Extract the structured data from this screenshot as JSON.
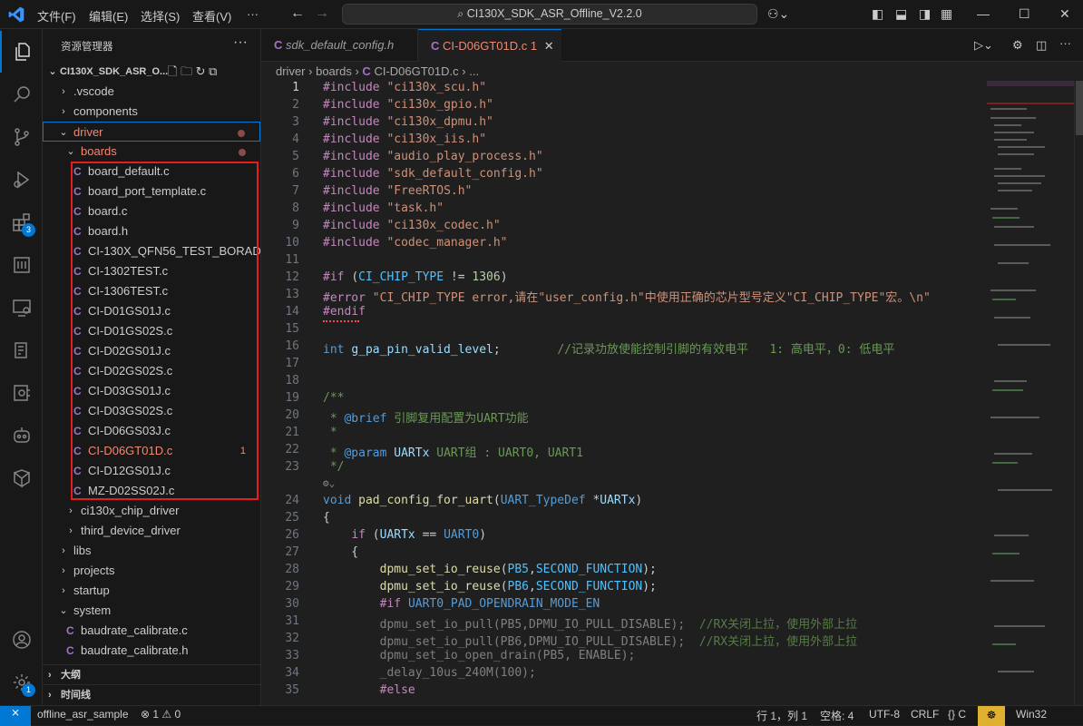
{
  "titlebar": {
    "menus": [
      "文件(F)",
      "编辑(E)",
      "选择(S)",
      "查看(V)"
    ],
    "more": "···",
    "search_text": "CI130X_SDK_ASR_Offline_V2.2.0"
  },
  "activity": {
    "extensions_badge": "3",
    "settings_badge": "1"
  },
  "sidebar": {
    "title": "资源管理器",
    "more": "···",
    "root": "CI130X_SDK_ASR_O...",
    "items": [
      {
        "label": ".vscode"
      },
      {
        "label": "components"
      },
      {
        "label": "driver"
      },
      {
        "label": "boards"
      },
      {
        "label": "board_default.c"
      },
      {
        "label": "board_port_template.c"
      },
      {
        "label": "board.c"
      },
      {
        "label": "board.h"
      },
      {
        "label": "CI-130X_QFN56_TEST_BORAD.c"
      },
      {
        "label": "CI-1302TEST.c"
      },
      {
        "label": "CI-1306TEST.c"
      },
      {
        "label": "CI-D01GS01J.c"
      },
      {
        "label": "CI-D01GS02S.c"
      },
      {
        "label": "CI-D02GS01J.c"
      },
      {
        "label": "CI-D02GS02S.c"
      },
      {
        "label": "CI-D03GS01J.c"
      },
      {
        "label": "CI-D03GS02S.c"
      },
      {
        "label": "CI-D06GS03J.c"
      },
      {
        "label": "CI-D06GT01D.c",
        "errors": "1"
      },
      {
        "label": "CI-D12GS01J.c"
      },
      {
        "label": "MZ-D02SS02J.c"
      },
      {
        "label": "ci130x_chip_driver"
      },
      {
        "label": "third_device_driver"
      },
      {
        "label": "libs"
      },
      {
        "label": "projects"
      },
      {
        "label": "startup"
      },
      {
        "label": "system"
      },
      {
        "label": "baudrate_calibrate.c"
      },
      {
        "label": "baudrate_calibrate.h"
      }
    ],
    "outline": "大纲",
    "timeline": "时间线"
  },
  "tabs": [
    {
      "label": "sdk_default_config.h"
    },
    {
      "label": "CI-D06GT01D.c",
      "errors": "1"
    }
  ],
  "breadcrumb": [
    "driver",
    "boards",
    "CI-D06GT01D.c",
    "..."
  ],
  "code": {
    "line_numbers": [
      "1",
      "2",
      "3",
      "4",
      "5",
      "6",
      "7",
      "8",
      "9",
      "10",
      "11",
      "12",
      "13",
      "14",
      "15",
      "16",
      "17",
      "18",
      "19",
      "20",
      "21",
      "22",
      "23",
      "24",
      "25",
      "26",
      "27",
      "28",
      "29",
      "30",
      "31",
      "32",
      "33",
      "34",
      "35"
    ],
    "lines": [
      [
        [
          "kw",
          "#include "
        ],
        [
          "str",
          "\"ci130x_scu.h\""
        ]
      ],
      [
        [
          "kw",
          "#include "
        ],
        [
          "str",
          "\"ci130x_gpio.h\""
        ]
      ],
      [
        [
          "kw",
          "#include "
        ],
        [
          "str",
          "\"ci130x_dpmu.h\""
        ]
      ],
      [
        [
          "kw",
          "#include "
        ],
        [
          "str",
          "\"ci130x_iis.h\""
        ]
      ],
      [
        [
          "kw",
          "#include "
        ],
        [
          "str",
          "\"audio_play_process.h\""
        ]
      ],
      [
        [
          "kw",
          "#include "
        ],
        [
          "str",
          "\"sdk_default_config.h\""
        ]
      ],
      [
        [
          "kw",
          "#include "
        ],
        [
          "str",
          "\"FreeRTOS.h\""
        ]
      ],
      [
        [
          "kw",
          "#include "
        ],
        [
          "str",
          "\"task.h\""
        ]
      ],
      [
        [
          "kw",
          "#include "
        ],
        [
          "str",
          "\"ci130x_codec.h\""
        ]
      ],
      [
        [
          "kw",
          "#include "
        ],
        [
          "str",
          "\"codec_manager.h\""
        ]
      ],
      [],
      [
        [
          "kw",
          "#if "
        ],
        [
          "t",
          "("
        ],
        [
          "mac",
          "CI_CHIP_TYPE"
        ],
        [
          "t",
          " != "
        ],
        [
          "num",
          "1306"
        ],
        [
          "t",
          ")"
        ]
      ],
      [
        [
          "kw",
          "#error "
        ],
        [
          "str",
          "\"CI_CHIP_TYPE error,请在\"user_config.h\"中使用正确的芯片型号定义\"CI_CHIP_TYPE\"宏。\\n\""
        ]
      ],
      [
        [
          "kw",
          "#endif"
        ]
      ],
      [],
      [
        [
          "ty",
          "int "
        ],
        [
          "var",
          "g_pa_pin_valid_level"
        ],
        [
          "t",
          ";        "
        ],
        [
          "cm",
          "//记录功放使能控制引脚的有效电平   1: 高电平，0: 低电平"
        ]
      ],
      [],
      [],
      [
        [
          "cm",
          "/**"
        ]
      ],
      [
        [
          "cm",
          " * "
        ],
        [
          "tag",
          "@brief "
        ],
        [
          "cm",
          "引脚复用配置为UART功能"
        ]
      ],
      [
        [
          "cm",
          " *"
        ]
      ],
      [
        [
          "cm",
          " * "
        ],
        [
          "tag",
          "@param "
        ],
        [
          "var",
          "UARTx "
        ],
        [
          "cm",
          "UART组 : UART0, UART1"
        ]
      ],
      [
        [
          "cm",
          " */"
        ]
      ],
      [
        [
          "ty",
          "void "
        ],
        [
          "fn",
          "pad_config_for_uart"
        ],
        [
          "t",
          "("
        ],
        [
          "ty",
          "UART_TypeDef "
        ],
        [
          "t",
          "*"
        ],
        [
          "var",
          "UARTx"
        ],
        [
          "t",
          ")"
        ]
      ],
      [
        [
          "t",
          "{"
        ]
      ],
      [
        [
          "t",
          "    "
        ],
        [
          "kw",
          "if "
        ],
        [
          "t",
          "("
        ],
        [
          "var",
          "UARTx"
        ],
        [
          "t",
          " == "
        ],
        [
          "ty",
          "UART0"
        ],
        [
          "t",
          ")"
        ]
      ],
      [
        [
          "t",
          "    {"
        ]
      ],
      [
        [
          "t",
          "        "
        ],
        [
          "fn",
          "dpmu_set_io_reuse"
        ],
        [
          "t",
          "("
        ],
        [
          "mac",
          "PB5"
        ],
        [
          "t",
          ","
        ],
        [
          "mac",
          "SECOND_FUNCTION"
        ],
        [
          "t",
          ");"
        ]
      ],
      [
        [
          "t",
          "        "
        ],
        [
          "fn",
          "dpmu_set_io_reuse"
        ],
        [
          "t",
          "("
        ],
        [
          "mac",
          "PB6"
        ],
        [
          "t",
          ","
        ],
        [
          "mac",
          "SECOND_FUNCTION"
        ],
        [
          "t",
          ");"
        ]
      ],
      [
        [
          "t",
          "        "
        ],
        [
          "kw",
          "#if "
        ],
        [
          "ty",
          "UART0_PAD_OPENDRAIN_MODE_EN"
        ]
      ],
      [
        [
          "t",
          "        "
        ],
        [
          "dim",
          "dpmu_set_io_pull(PB5,DPMU_IO_PULL_DISABLE);  "
        ],
        [
          "cmd",
          "//RX关闭上拉，使用外部上拉"
        ]
      ],
      [
        [
          "t",
          "        "
        ],
        [
          "dim",
          "dpmu_set_io_pull(PB6,DPMU_IO_PULL_DISABLE);  "
        ],
        [
          "cmd",
          "//RX关闭上拉，使用外部上拉"
        ]
      ],
      [
        [
          "t",
          "        "
        ],
        [
          "dim",
          "dpmu_set_io_open_drain(PB5, ENABLE);"
        ]
      ],
      [
        [
          "t",
          "        "
        ],
        [
          "dim",
          "_delay_10us_240M(100);"
        ]
      ],
      [
        [
          "t",
          "        "
        ],
        [
          "kw",
          "#else"
        ]
      ]
    ]
  },
  "statusbar": {
    "remote": "offline_asr_sample",
    "problems": "⊗ 1 ⚠ 0",
    "position": "行 1，列 1",
    "spaces": "空格: 4",
    "encoding": "UTF-8",
    "eol": "CRLF",
    "language": "{} C",
    "platform": "Win32"
  }
}
